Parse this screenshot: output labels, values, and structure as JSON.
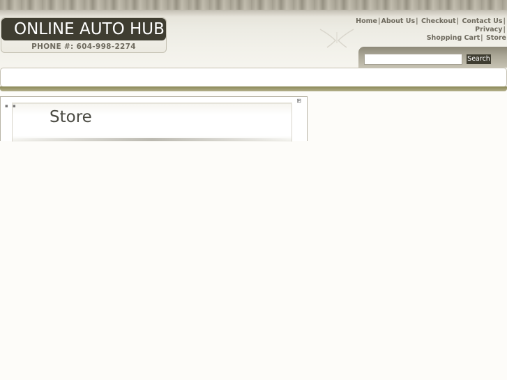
{
  "header": {
    "site_title": "ONLINE AUTO HUB",
    "phone": "PHONE #: 604-998-2274"
  },
  "nav": {
    "items": [
      {
        "label": "Home"
      },
      {
        "label": "About Us"
      },
      {
        "label": "Checkout"
      },
      {
        "label": "Contact Us"
      },
      {
        "label": "Privacy"
      },
      {
        "label": "Shopping Cart"
      },
      {
        "label": "Store"
      }
    ],
    "separator": "|"
  },
  "search": {
    "placeholder": "",
    "button_label": "Search"
  },
  "content": {
    "title": "Store"
  },
  "colors": {
    "logo_bg": "#3f3d31",
    "nav_text": "#6e6a5e",
    "menu_underline": "#8a8757"
  },
  "icons": {
    "corner_decoration": "ornament-icon",
    "expand": "expand-icon"
  }
}
